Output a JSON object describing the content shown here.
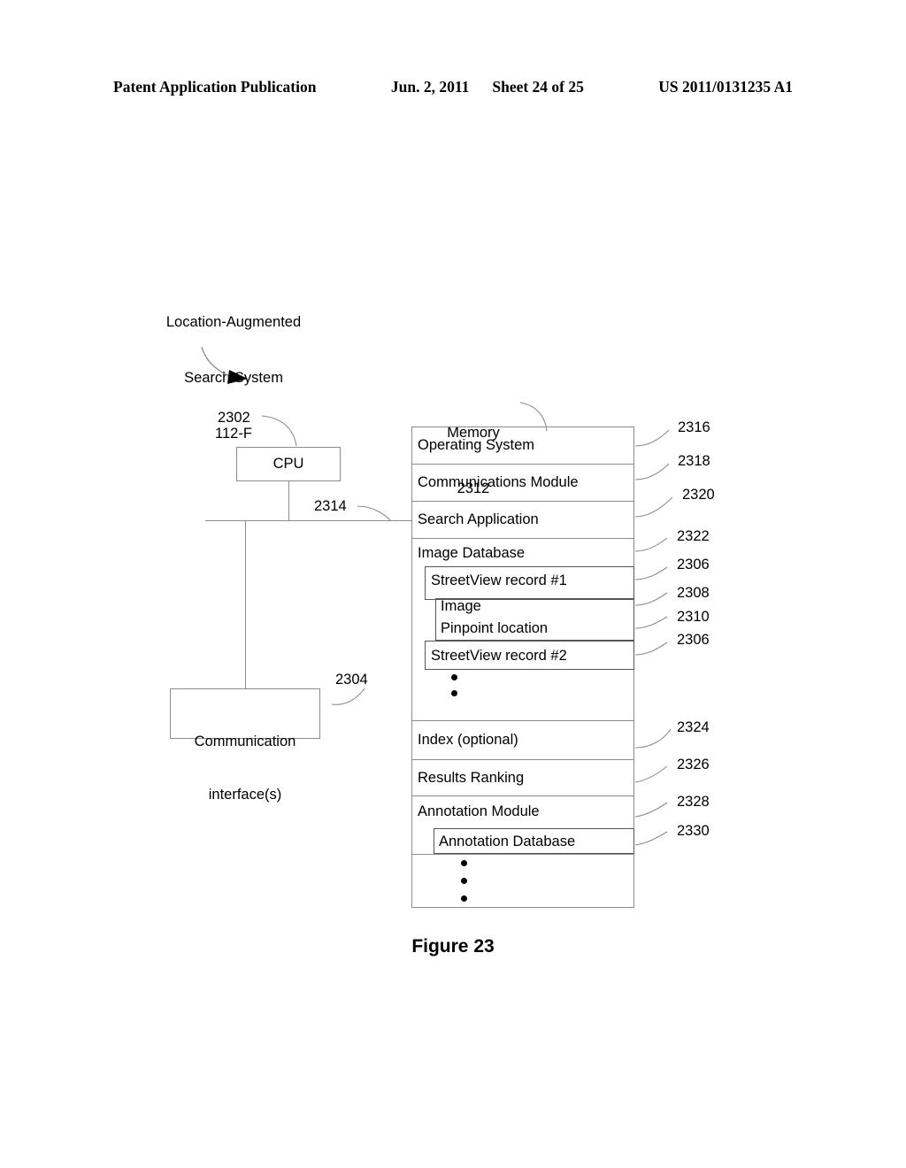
{
  "header": {
    "publication": "Patent Application Publication",
    "date": "Jun. 2, 2011",
    "sheet": "Sheet 24 of 25",
    "docnum": "US 2011/0131235 A1"
  },
  "figure": {
    "caption": "Figure 23"
  },
  "system": {
    "title_line1": "Location-Augmented",
    "title_line2": "Search System",
    "title_line3": "112-F"
  },
  "blocks": {
    "cpu": {
      "label": "CPU",
      "ref": "2302"
    },
    "comm_interface": {
      "label_line1": "Communication",
      "label_line2": "interface(s)",
      "ref": "2304"
    },
    "bus": {
      "ref": "2314"
    },
    "memory": {
      "label": "Memory",
      "ref": "2312"
    }
  },
  "memory_entries": [
    {
      "label": "Operating System",
      "ref": "2316",
      "level": 0
    },
    {
      "label": "Communications Module",
      "ref": "2318",
      "level": 0
    },
    {
      "label": "Search Application",
      "ref": "2320",
      "level": 0
    },
    {
      "label": "Image Database",
      "ref": "2322",
      "level": 0
    },
    {
      "label": "StreetView record #1",
      "ref": "2306",
      "level": 1
    },
    {
      "label": "Image",
      "ref": "2308",
      "level": 2
    },
    {
      "label": "Pinpoint location",
      "ref": "2310",
      "level": 2
    },
    {
      "label": "StreetView record #2",
      "ref": "2306",
      "level": 1
    },
    {
      "label": "Index (optional)",
      "ref": "2324",
      "level": 0
    },
    {
      "label": "Results Ranking",
      "ref": "2326",
      "level": 0
    },
    {
      "label": "Annotation Module",
      "ref": "2328",
      "level": 0
    },
    {
      "label": "Annotation Database",
      "ref": "2330",
      "level": 1
    }
  ],
  "ref_numerals": [
    "2316",
    "2318",
    "2320",
    "2322",
    "2306",
    "2308",
    "2310",
    "2306",
    "2324",
    "2326",
    "2328",
    "2330"
  ],
  "colors": {
    "line": "#8c8c8c",
    "text": "#000000",
    "background": "#ffffff"
  }
}
